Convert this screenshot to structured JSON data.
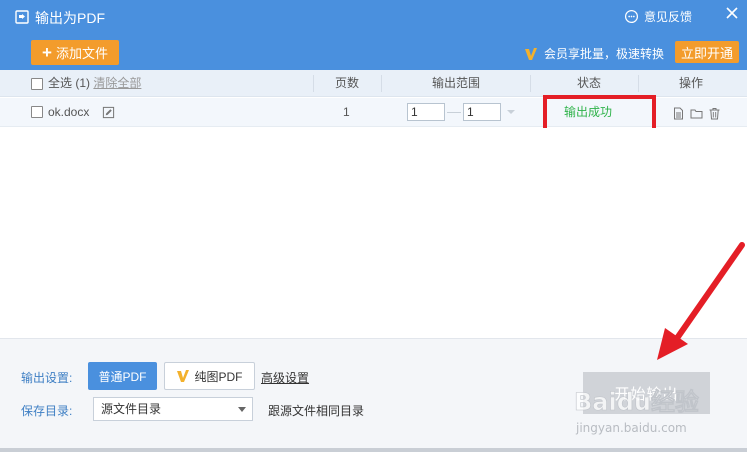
{
  "window": {
    "title": "输出为PDF",
    "feedback_label": "意见反馈",
    "close_icon": "close-icon"
  },
  "toolbar": {
    "add_file_label": "添加文件",
    "vip_promo": "会员享批量，极速转换",
    "open_vip_label": "立即开通",
    "colors": {
      "header_bg": "#4a90de",
      "accent_orange": "#f39c2c"
    }
  },
  "table": {
    "select_all_label": "全选",
    "count_label": "(1)",
    "clear_all_label": "清除全部",
    "columns": [
      "页数",
      "输出范围",
      "状态",
      "操作"
    ],
    "rows": [
      {
        "filename": "ok.docx",
        "pages": "1",
        "range_from": "1",
        "range_to": "1",
        "status": "输出成功",
        "status_color": "#2fb34a",
        "actions": [
          "file-icon",
          "folder-icon",
          "trash-icon"
        ]
      }
    ]
  },
  "settings": {
    "output_label": "输出设置:",
    "normal_pdf_label": "普通PDF",
    "pure_pdf_label": "纯图PDF",
    "advanced_label": "高级设置",
    "save_dir_label": "保存目录:",
    "save_dir_value": "源文件目录",
    "same_dir_label": "跟源文件相同目录",
    "start_label": "开始输出"
  },
  "overlay": {
    "highlight_color": "#e41e26",
    "watermark_text": "Baidu经验",
    "watermark_url": "jingyan.baidu.com"
  }
}
